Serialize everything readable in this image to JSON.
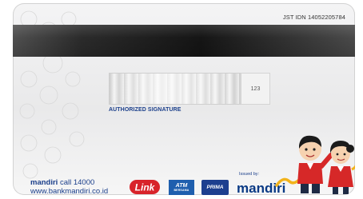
{
  "card": {
    "serial": "JST IDN 14052205784",
    "cvv_text": "123",
    "signature_label": "AUTHORIZED SIGNATURE",
    "brand_bold": "mandiri",
    "brand_call": " call 14000",
    "website": "www.bankmandiri.co.id",
    "issued_by": "Issued by:",
    "issuer_name": "mandiri"
  },
  "logos": {
    "link": "Link",
    "atm": "ATM",
    "atm_sub": "BERSAMA",
    "prima": "PRIMA"
  },
  "colors": {
    "brand_blue": "#1b3f8b",
    "link_red": "#d8232a",
    "atm_blue": "#1f5fae",
    "swoosh_gold": "#f2b31b"
  }
}
